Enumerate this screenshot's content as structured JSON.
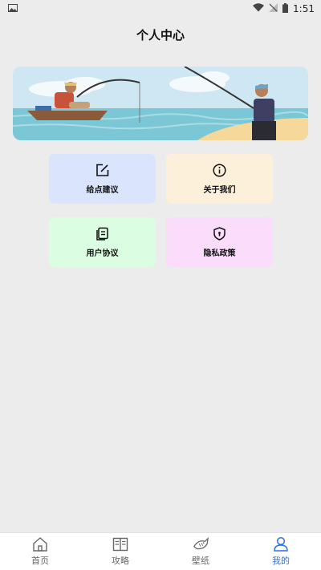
{
  "status_bar": {
    "time": "1:51",
    "icons": [
      "image-icon",
      "wifi-icon",
      "no-signal-icon",
      "battery-icon"
    ]
  },
  "header": {
    "title": "个人中心"
  },
  "banner": {
    "image": "fishing-illustration"
  },
  "cards": [
    {
      "id": "feedback",
      "label": "给点建议",
      "icon": "edit-icon",
      "color": "#dbe4fd"
    },
    {
      "id": "about",
      "label": "关于我们",
      "icon": "info-icon",
      "color": "#fdf0da"
    },
    {
      "id": "agreement",
      "label": "用户协议",
      "icon": "document-icon",
      "color": "#dbfde1"
    },
    {
      "id": "privacy",
      "label": "隐私政策",
      "icon": "shield-icon",
      "color": "#fbdcfb"
    }
  ],
  "tabbar": {
    "active_index": 3,
    "active_color": "#2f6fde",
    "items": [
      {
        "label": "首页",
        "icon": "home-icon"
      },
      {
        "label": "攻略",
        "icon": "book-icon"
      },
      {
        "label": "壁纸",
        "icon": "fish-icon"
      },
      {
        "label": "我的",
        "icon": "user-icon"
      }
    ]
  }
}
